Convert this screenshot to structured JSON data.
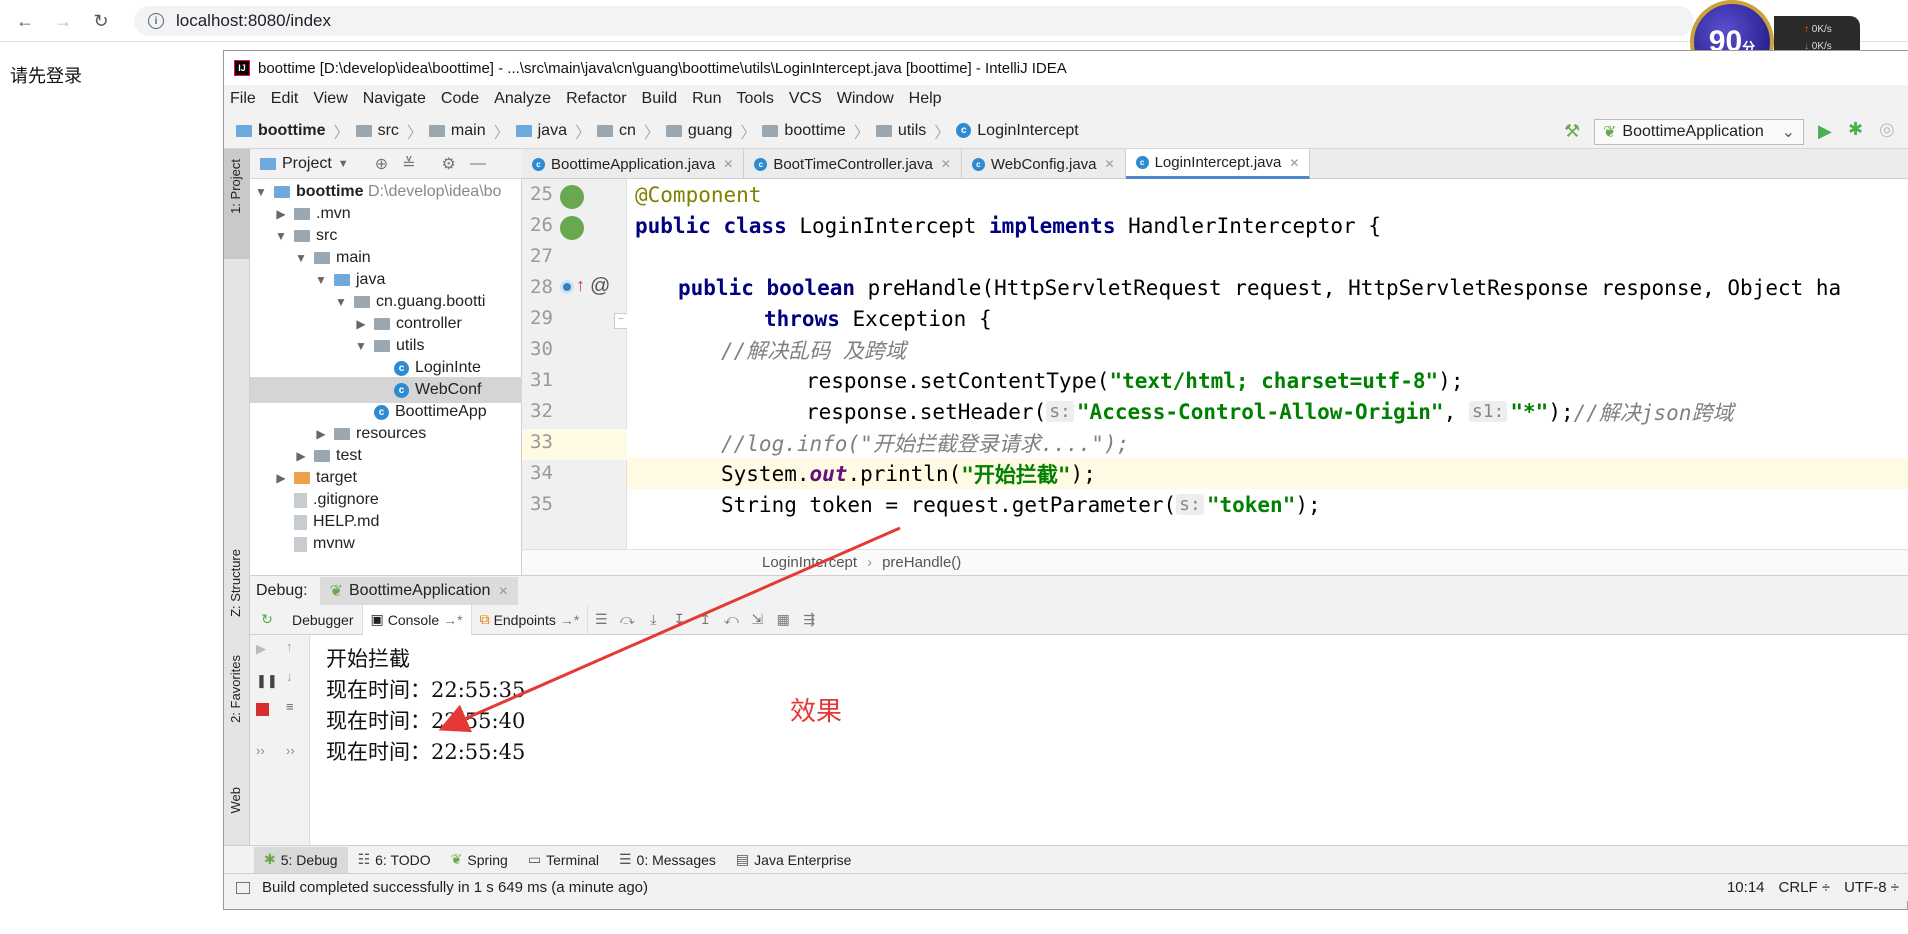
{
  "browser": {
    "url": "localhost:8080/index",
    "page_message": "请先登录",
    "back_icon": "←",
    "forward_icon": "→",
    "reload_icon": "↻"
  },
  "speed_widget": {
    "score": "90",
    "unit": "分",
    "up": "0K/s",
    "down": "0K/s"
  },
  "ide": {
    "title": "boottime [D:\\develop\\idea\\boottime] - ...\\src\\main\\java\\cn\\guang\\boottime\\utils\\LoginIntercept.java [boottime] - IntelliJ IDEA",
    "logo": "IJ",
    "menu": [
      "File",
      "Edit",
      "View",
      "Navigate",
      "Code",
      "Analyze",
      "Refactor",
      "Build",
      "Run",
      "Tools",
      "VCS",
      "Window",
      "Help"
    ],
    "breadcrumbs": [
      "boottime",
      "src",
      "main",
      "java",
      "cn",
      "guang",
      "boottime",
      "utils",
      "LoginIntercept"
    ],
    "run_config": "BoottimeApplication",
    "left_strip": {
      "project": "1: Project",
      "structure": "Z: Structure",
      "favorites": "2: Favorites",
      "web": "Web"
    },
    "project_panel": {
      "title": "Project",
      "tree": [
        {
          "label": "boottime",
          "extra": "D:\\develop\\idea\\bo"
        },
        {
          "label": ".mvn"
        },
        {
          "label": "src"
        },
        {
          "label": "main"
        },
        {
          "label": "java"
        },
        {
          "label": "cn.guang.bootti"
        },
        {
          "label": "controller"
        },
        {
          "label": "utils"
        },
        {
          "label": "LoginInte"
        },
        {
          "label": "WebConf"
        },
        {
          "label": "BoottimeApp"
        },
        {
          "label": "resources"
        },
        {
          "label": "test"
        },
        {
          "label": "target"
        },
        {
          "label": ".gitignore"
        },
        {
          "label": "HELP.md"
        },
        {
          "label": "mvnw"
        }
      ]
    },
    "editor_tabs": [
      "BoottimeApplication.java",
      "BootTimeController.java",
      "WebConfig.java",
      "LoginIntercept.java"
    ],
    "line_numbers": [
      "25",
      "26",
      "27",
      "28",
      "29",
      "30",
      "31",
      "32",
      "33",
      "34",
      "35"
    ],
    "code": {
      "l25": "@Component",
      "l26_kw1": "public class ",
      "l26_name": "LoginIntercept ",
      "l26_kw2": "implements ",
      "l26_rest": "HandlerInterceptor {",
      "l28_kw": "public boolean ",
      "l28_rest": "preHandle(HttpServletRequest request, HttpServletResponse response, Object ha",
      "l29_kw": "throws ",
      "l29_rest": "Exception {",
      "l30": "//解决乱码 及跨域",
      "l31_a": "response.setContentType(",
      "l31_str": "\"text/html; charset=utf-8\"",
      "l31_b": ");",
      "l32_a": "response.setHeader(",
      "l32_hint1": "s:",
      "l32_str1": "\"Access-Control-Allow-Origin\"",
      "l32_mid": ", ",
      "l32_hint2": "s1:",
      "l32_str2": "\"*\"",
      "l32_b": ");",
      "l32_cmt": "//解决json跨域",
      "l33": "//log.info(\"开始拦截登录请求....\");",
      "l34_a": "System.",
      "l34_fld": "out",
      "l34_b": ".println(",
      "l34_str": "\"开始拦截\"",
      "l34_c": ");",
      "l35_a": "String token = request.getParameter(",
      "l35_hint": "s:",
      "l35_str": "\"token\"",
      "l35_b": ");"
    },
    "code_crumbs": [
      "LoginIntercept",
      "preHandle()"
    ],
    "debug": {
      "label": "Debug:",
      "session": "BoottimeApplication",
      "tabs": [
        "Debugger",
        "Console",
        "Endpoints"
      ],
      "console_lines": [
        "开始拦截",
        "现在时间：22:55:35",
        "现在时间：22:55:40",
        "现在时间：22:55:45"
      ],
      "annotation": "效果"
    },
    "bottom_tabs": [
      "5: Debug",
      "6: TODO",
      "Spring",
      "Terminal",
      "0: Messages",
      "Java Enterprise"
    ],
    "status": {
      "message": "Build completed successfully in 1 s 649 ms (a minute ago)",
      "position": "10:14",
      "line_sep": "CRLF ÷",
      "encoding": "UTF-8 ÷"
    }
  },
  "colors": {
    "arrow": "#e53935",
    "highlight_line": "#fffae3",
    "effect_text": "#e53935"
  }
}
